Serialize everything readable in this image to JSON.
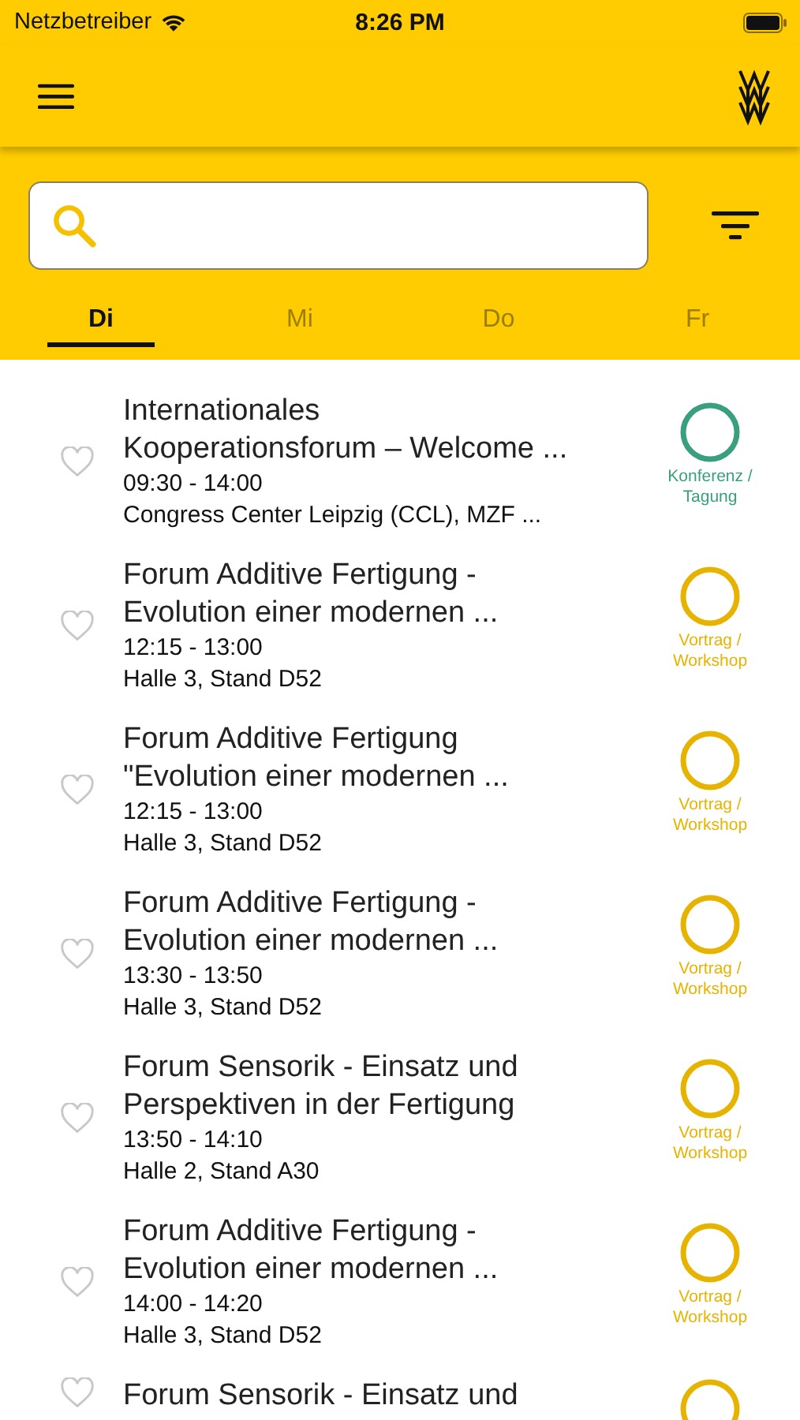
{
  "status_bar": {
    "carrier": "Netzbetreiber",
    "time": "8:26 PM"
  },
  "tabs": [
    {
      "label": "Di",
      "selected": true
    },
    {
      "label": "Mi",
      "selected": false
    },
    {
      "label": "Do",
      "selected": false
    },
    {
      "label": "Fr",
      "selected": false
    }
  ],
  "events": [
    {
      "title": [
        "Internationales",
        "Kooperationsforum – Welcome ..."
      ],
      "time": "09:30 - 14:00",
      "location": " Congress Center Leipzig (CCL), MZF ...",
      "category": "Konferenz / Tagung",
      "color": "#3a9f7f",
      "favorite": false
    },
    {
      "title": [
        "Forum Additive Fertigung -",
        "Evolution einer modernen ..."
      ],
      "time": "12:15 - 13:00",
      "location": "Halle 3, Stand D52",
      "category": "Vortrag / Workshop",
      "color": "#e6b400",
      "favorite": false
    },
    {
      "title": [
        "Forum Additive Fertigung",
        "\"Evolution einer modernen ..."
      ],
      "time": "12:15 - 13:00",
      "location": "Halle 3, Stand D52",
      "category": "Vortrag / Workshop",
      "color": "#e6b400",
      "favorite": false
    },
    {
      "title": [
        "Forum Additive Fertigung -",
        "Evolution einer modernen ..."
      ],
      "time": "13:30 - 13:50",
      "location": "Halle 3, Stand D52",
      "category": "Vortrag / Workshop",
      "color": "#e6b400",
      "favorite": false
    },
    {
      "title": [
        "Forum Sensorik - Einsatz und",
        "Perspektiven in der Fertigung"
      ],
      "time": "13:50 - 14:10",
      "location": "Halle 2, Stand A30",
      "category": "Vortrag / Workshop",
      "color": "#e6b400",
      "favorite": false
    },
    {
      "title": [
        "Forum Additive Fertigung -",
        "Evolution einer modernen ..."
      ],
      "time": "14:00 - 14:20",
      "location": "Halle 3, Stand D52",
      "category": "Vortrag / Workshop",
      "color": "#e6b400",
      "favorite": false
    },
    {
      "title": [
        "Forum Sensorik - Einsatz und"
      ],
      "color": "#e6b400",
      "favorite": false
    }
  ]
}
